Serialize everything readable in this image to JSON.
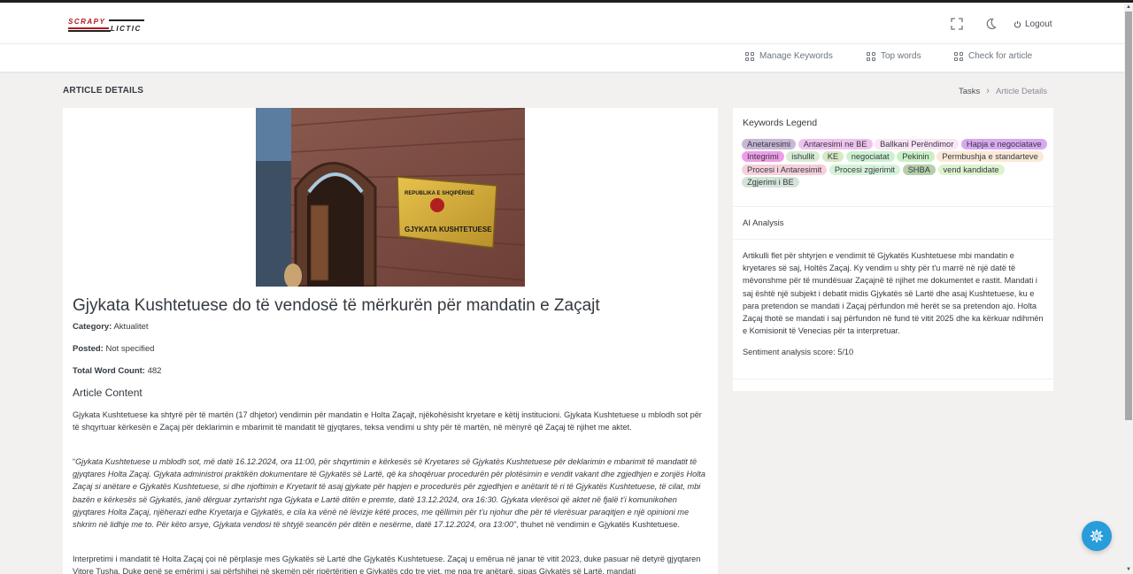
{
  "brand": {
    "line1": "SCRAPY",
    "line2": "LICTIC"
  },
  "header": {
    "logout_label": "Logout"
  },
  "nav": {
    "items": [
      {
        "label": "Manage Keywords"
      },
      {
        "label": "Top words"
      },
      {
        "label": "Check for article"
      }
    ]
  },
  "page": {
    "title": "ARTICLE DETAILS"
  },
  "breadcrumb": {
    "parent": "Tasks",
    "current": "Article Details"
  },
  "article": {
    "image_alt": "Gjykata Kushtetuese building plaque",
    "plaque_text": [
      "REPUBLIKA E SHQIPËRISË",
      "GJYKATA KUSHTETUESE"
    ],
    "title": "Gjykata Kushtetuese do të vendosë të mërkurën për mandatin e Zaçajt",
    "category_label": "Category:",
    "category_value": "Aktualitet",
    "posted_label": "Posted:",
    "posted_value": "Not specified",
    "word_count_label": "Total Word Count:",
    "word_count_value": "482",
    "content_heading": "Article Content",
    "paragraph1": "Gjykata Kushtetuese ka shtyrë për të martën (17 dhjetor) vendimin për mandatin e Holta Zaçajt, njëkohësisht kryetare e këtij institucioni. Gjykata Kushtetuese u mblodh sot për të shqyrtuar kërkesën e Zaçaj për deklarimin e mbarimit të mandatit të gjyqtares, teksa vendimi u shty për të martën, në mënyrë që Zaçaj të njihet me aktet.",
    "quote_open": "“",
    "quote_text": "Gjykata Kushtetuese u mblodh sot, më datë 16.12.2024, ora 11:00, për shqyrtimin e kërkesës së Kryetares së Gjykatës Kushtetuese për deklarimin e mbarimit të mandatit të gjyqtares Holta Zaçaj. Gjykata administroi praktikën dokumentare të Gjykatës së Lartë, që ka shoqëruar procedurën për plotësimin e vendit vakant dhe zgjedhjen e zonjës Holta Zaçaj si anëtare e Gjykatës Kushtetuese, si dhe njoftimin e Kryetarit të asaj gjykate për hapjen e procedurës për zgjedhjen e anëtarit të ri të Gjykatës Kushtetuese, të cilat, mbi bazën e kërkesës së Gjykatës, janë dërguar zyrtarisht nga Gjykata e Lartë ditën e premte, datë 13.12.2024, ora 16:30. Gjykata vlerësoi që aktet në fjalë t’i komunikohen gjyqtares Holta Zaçaj, njëherazi edhe Kryetarja e Gjykatës, e cila ka vënë në lëvizje këtë proces, me qëllimin për t’u njohur dhe për të vlerësuar paraqitjen e një opinioni me shkrim në lidhje me to. Për këto arsye, Gjykata vendosi të shtyjë seancën për ditën e nesërme, datë 17.12.2024, ora 13:00”",
    "quote_tail": ", thuhet në vendimin e Gjykatës Kushtetuese.",
    "paragraph3": "Interpretimi i mandatit të Holta Zaçaj çoi në përplasje mes Gjykatës së Lartë dhe Gjykatës Kushtetuese. Zaçaj u emërua në janar të vitit 2023, duke pasuar në detyrë gjyqtaren Vitore Tusha. Duke qenë se emërimi i saj përfshihej në skemën për ripërtëritjen e Gjykatës cdo tre vjet, me nga tre anëtarë, sipas Gjykatës së Lartë, mandati"
  },
  "legend": {
    "title": "Keywords Legend",
    "keywords": [
      {
        "label": "Anetaresimi",
        "color": "#c8b7d6"
      },
      {
        "label": "Antaresimi ne BE",
        "color": "#f0c2ee"
      },
      {
        "label": "Ballkani Perëndimor",
        "color": "#fbe4f5"
      },
      {
        "label": "Hapja e negociatave",
        "color": "#d8a8f0"
      },
      {
        "label": "Integrimi",
        "color": "#ee9ee8"
      },
      {
        "label": "ishullit",
        "color": "#d7ecd2"
      },
      {
        "label": "KE",
        "color": "#d6e8c4"
      },
      {
        "label": "negociatat",
        "color": "#cbf2cf"
      },
      {
        "label": "Pekinin",
        "color": "#c9f0c4"
      },
      {
        "label": "Permbushja e standarteve",
        "color": "#fbe8d6"
      },
      {
        "label": "Procesi i Antaresimit",
        "color": "#f6d0da"
      },
      {
        "label": "Procesi zgjerimit",
        "color": "#d6f3da"
      },
      {
        "label": "SHBA",
        "color": "#b6cfa9"
      },
      {
        "label": "vend kandidate",
        "color": "#dcf3ce"
      },
      {
        "label": "Zgjerimi i BE",
        "color": "#d5e4d8"
      }
    ]
  },
  "ai": {
    "title": "AI Analysis",
    "text": "Artikulli flet për shtyrjen e vendimit të Gjykatës Kushtetuese mbi mandatin e kryetares së saj, Holtës Zaçaj. Ky vendim u shty për t'u marrë në një datë të mëvonshme për të mundësuar Zaçajnë të njihet me dokumentet e rastit. Mandati i saj është një subjekt i debatit midis Gjykatës së Lartë dhe asaj Kushtetuese, ku e para pretendon se mandati i Zaçaj përfundon më herët se sa pretendon ajo. Holta Zaçaj thotë se mandati i saj përfundon në fund të vitit 2025 dhe ka kërkuar ndihmën e Komisionit të Venecias për ta interpretuar.",
    "score": "Sentiment analysis score: 5/10"
  },
  "colors": {
    "accent": "#299cdb",
    "brand_red": "#b5161c"
  }
}
